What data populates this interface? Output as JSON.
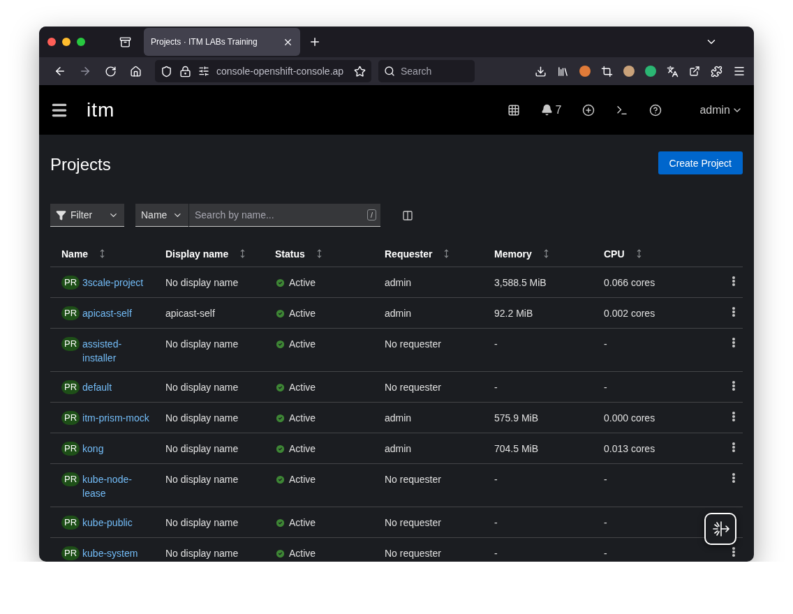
{
  "browser": {
    "tab_title": "Projects · ITM LABs Training",
    "url": "console-openshift-console.ap",
    "search_placeholder": "Search"
  },
  "masthead": {
    "logo": "itm",
    "notification_count": "7",
    "user": "admin"
  },
  "page": {
    "title": "Projects",
    "create_button": "Create Project"
  },
  "toolbar": {
    "filter": "Filter",
    "attribute": "Name",
    "search_placeholder": "Search by name...",
    "shortcut": "/"
  },
  "table": {
    "columns": [
      "Name",
      "Display name",
      "Status",
      "Requester",
      "Memory",
      "CPU"
    ],
    "rows": [
      {
        "badge": "PR",
        "name": "3scale-project",
        "display_name": "No display name",
        "status": "Active",
        "requester": "admin",
        "memory": "3,588.5 MiB",
        "cpu": "0.066 cores"
      },
      {
        "badge": "PR",
        "name": "apicast-self",
        "display_name": "apicast-self",
        "status": "Active",
        "requester": "admin",
        "memory": "92.2 MiB",
        "cpu": "0.002 cores"
      },
      {
        "badge": "PR",
        "name": "assisted-installer",
        "display_name": "No display name",
        "status": "Active",
        "requester": "No requester",
        "memory": "-",
        "cpu": "-"
      },
      {
        "badge": "PR",
        "name": "default",
        "display_name": "No display name",
        "status": "Active",
        "requester": "No requester",
        "memory": "-",
        "cpu": "-"
      },
      {
        "badge": "PR",
        "name": "itm-prism-mock",
        "display_name": "No display name",
        "status": "Active",
        "requester": "admin",
        "memory": "575.9 MiB",
        "cpu": "0.000 cores"
      },
      {
        "badge": "PR",
        "name": "kong",
        "display_name": "No display name",
        "status": "Active",
        "requester": "admin",
        "memory": "704.5 MiB",
        "cpu": "0.013 cores"
      },
      {
        "badge": "PR",
        "name": "kube-node-lease",
        "display_name": "No display name",
        "status": "Active",
        "requester": "No requester",
        "memory": "-",
        "cpu": "-"
      },
      {
        "badge": "PR",
        "name": "kube-public",
        "display_name": "No display name",
        "status": "Active",
        "requester": "No requester",
        "memory": "-",
        "cpu": "-"
      },
      {
        "badge": "PR",
        "name": "kube-system",
        "display_name": "No display name",
        "status": "Active",
        "requester": "No requester",
        "memory": "-",
        "cpu": "-"
      }
    ]
  }
}
